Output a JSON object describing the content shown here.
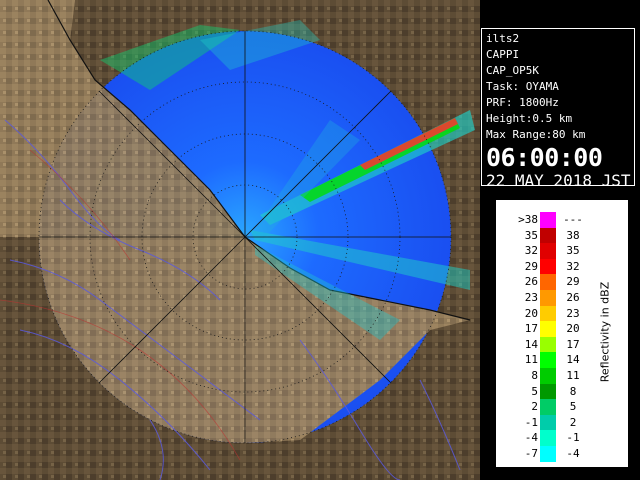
{
  "product": {
    "site": "ilts2",
    "product_type": "CAPPI",
    "product_name": "CAP_OP5K",
    "task": "Task: OYAMA",
    "prf": "PRF: 1800Hz",
    "height": "Height:0.5 km",
    "max_range": "Max Range:80 km",
    "time": "06:00:00",
    "date": "22 MAY 2018 JST"
  },
  "legend": {
    "unit_label": "Reflectivity in dBZ",
    "rows": [
      {
        "lo": ">38",
        "hi": "---",
        "color": "#ff00ff"
      },
      {
        "lo": "35",
        "hi": "38",
        "color": "#c00000"
      },
      {
        "lo": "32",
        "hi": "35",
        "color": "#e00000"
      },
      {
        "lo": "29",
        "hi": "32",
        "color": "#ff0000"
      },
      {
        "lo": "26",
        "hi": "29",
        "color": "#ff6600"
      },
      {
        "lo": "23",
        "hi": "26",
        "color": "#ff9900"
      },
      {
        "lo": "20",
        "hi": "23",
        "color": "#ffcc00"
      },
      {
        "lo": "17",
        "hi": "20",
        "color": "#ffff00"
      },
      {
        "lo": "14",
        "hi": "17",
        "color": "#99ff00"
      },
      {
        "lo": "11",
        "hi": "14",
        "color": "#00ff00"
      },
      {
        "lo": "8",
        "hi": "11",
        "color": "#00cc00"
      },
      {
        "lo": "5",
        "hi": "8",
        "color": "#009900"
      },
      {
        "lo": "2",
        "hi": "5",
        "color": "#00cc66"
      },
      {
        "lo": "-1",
        "hi": "2",
        "color": "#00ccaa"
      },
      {
        "lo": "-4",
        "hi": "-1",
        "color": "#00ffcc"
      },
      {
        "lo": "-7",
        "hi": "-4",
        "color": "#00ffff"
      }
    ]
  },
  "colors": {
    "radar_bg": "#1a5cff",
    "terrain_dark": "#5a4a36",
    "terrain_light": "#b9a27a",
    "rivers": "#5a5adc",
    "range_rings": "#1a1a1a"
  }
}
